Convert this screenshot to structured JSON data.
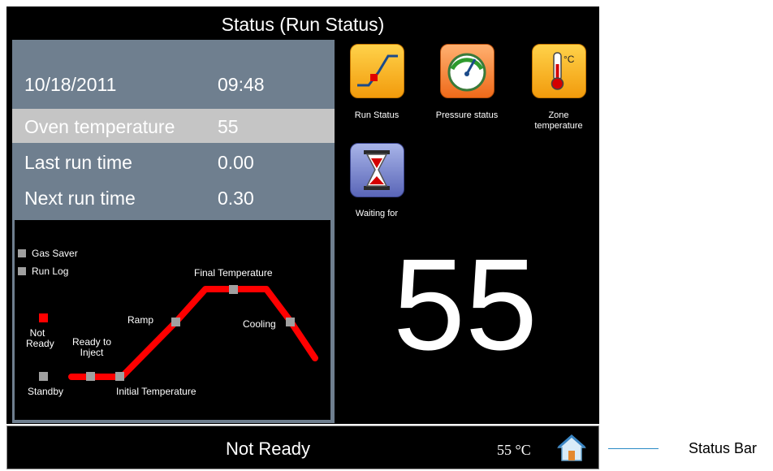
{
  "title": "Status (Run Status)",
  "info": {
    "date": "10/18/2011",
    "time": "09:48",
    "rows": [
      {
        "label": "Oven temperature",
        "value": "55"
      },
      {
        "label": "Last run time",
        "value": "0.00"
      },
      {
        "label": "Next run time",
        "value": "0.30"
      }
    ]
  },
  "diagram": {
    "legend": [
      "Gas Saver",
      "Run Log"
    ],
    "labels": {
      "not_ready": "Not\nReady",
      "standby": "Standby",
      "ready_to_inject": "Ready to\nInject",
      "initial_temperature": "Initial Temperature",
      "ramp": "Ramp",
      "final_temperature": "Final Temperature",
      "cooling": "Cooling"
    },
    "colors": {
      "active": "#ff0000",
      "inactive": "#a0a0a0"
    }
  },
  "apps": [
    {
      "label": "Run Status",
      "icon": "run-status-icon"
    },
    {
      "label": "Pressure status",
      "icon": "pressure-gauge-icon"
    },
    {
      "label": "Zone\ntemperature",
      "icon": "thermometer-icon"
    },
    {
      "label": "Waiting for",
      "icon": "hourglass-icon"
    }
  ],
  "big_temperature": "55",
  "status_bar": {
    "text": "Not Ready",
    "temperature": "55 °C",
    "home_icon": "home-icon"
  },
  "callout": "Status Bar"
}
